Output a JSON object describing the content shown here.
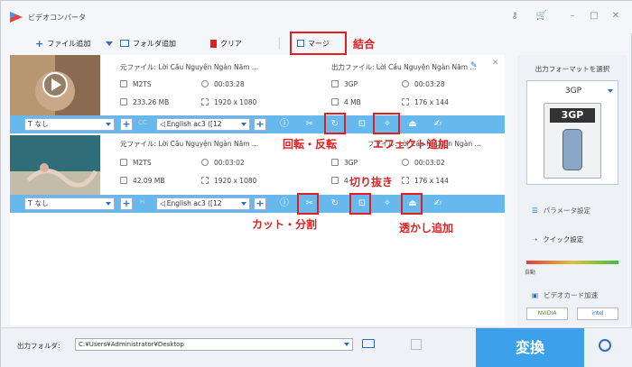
{
  "app": {
    "title": "ビデオコンバータ"
  },
  "toolbar": {
    "add_file": "ファイル追加",
    "add_folder": "フォルダ追加",
    "clear": "クリア",
    "merge": "マージ"
  },
  "files": [
    {
      "source_label": "元ファイル: Lời Cầu Nguyện Ngàn Năm ...",
      "src_format": "M2TS",
      "src_duration": "00:03:28",
      "src_size": "233.26 MB",
      "src_res": "1920 x 1080",
      "output_label": "出力ファイル: Lời Cầu Nguyện Ngàn Năm ...",
      "out_format": "3GP",
      "out_duration": "00:03:28",
      "out_size": "4 MB",
      "out_res": "176 x 144",
      "subtitle": "なし",
      "audio": "English ac3 ([12",
      "cc": "CC"
    },
    {
      "source_label": "元ファイル: Lời Cầu Nguyện Ngàn Năm ...",
      "src_format": "M2TS",
      "src_duration": "00:03:02",
      "src_size": "42.09 MB",
      "src_res": "1920 x 1080",
      "output_label": "ファイル: Lời Cầu Nguyện Ngàn ...",
      "out_format": "3GP",
      "out_duration": "00:03:02",
      "out_size": "4",
      "out_res": "176 x 144",
      "subtitle": "なし",
      "audio": "English ac3 ([12",
      "cc": "H"
    }
  ],
  "annotations": {
    "merge": "結合",
    "rotate": "回転・反転",
    "effect": "エフェクト追加",
    "crop": "切り抜き",
    "cut": "カット・分割",
    "watermark": "透かし追加"
  },
  "right_panel": {
    "format_label": "出力フォーマットを選択",
    "format": "3GP",
    "format_icon_text": "3GP",
    "params": "パラメータ設定",
    "quick": "クイック設定",
    "auto": "自動",
    "gpu": "ビデオカード加速",
    "nvidia": "NVIDIA",
    "intel": "intel"
  },
  "bottom": {
    "output_folder_label": "出力フォルダ:",
    "output_path": "C:¥Users¥Administrator¥Desktop",
    "convert": "変換"
  }
}
